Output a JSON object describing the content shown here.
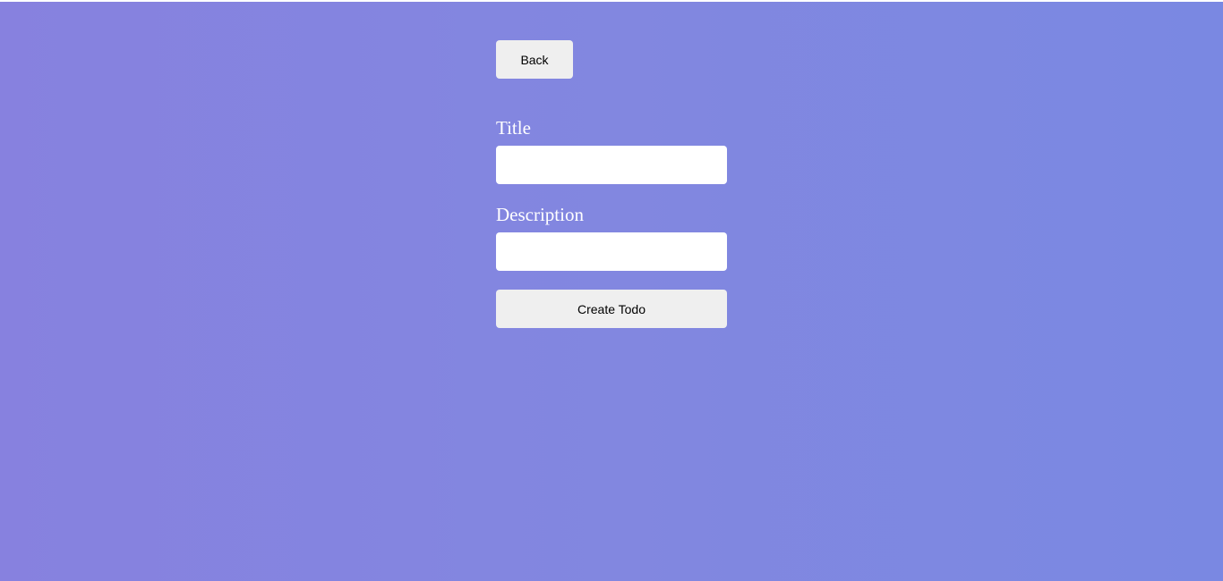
{
  "colors": {
    "background_start": "#8781df",
    "background_end": "#7a88e2",
    "button_bg": "#efefef",
    "input_bg": "#ffffff",
    "label_text": "#ffffff"
  },
  "nav": {
    "back_label": "Back"
  },
  "form": {
    "title_label": "Title",
    "title_value": "",
    "title_placeholder": "",
    "description_label": "Description",
    "description_value": "",
    "description_placeholder": "",
    "submit_label": "Create Todo"
  }
}
